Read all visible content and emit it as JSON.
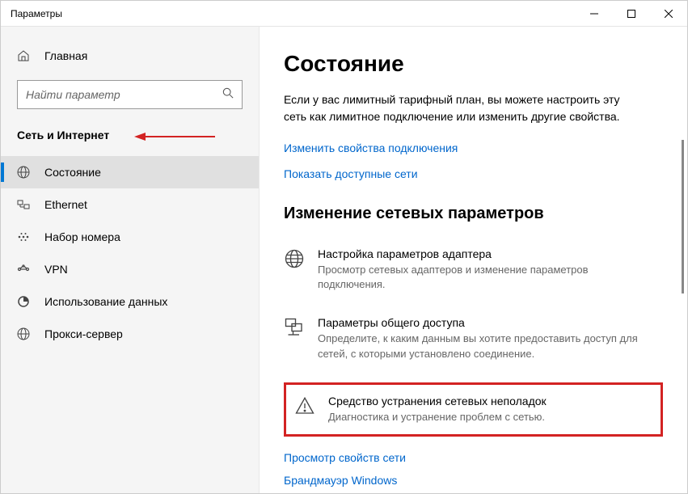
{
  "window": {
    "title": "Параметры"
  },
  "sidebar": {
    "home_label": "Главная",
    "search_placeholder": "Найти параметр",
    "category_label": "Сеть и Интернет",
    "items": [
      {
        "label": "Состояние"
      },
      {
        "label": "Ethernet"
      },
      {
        "label": "Набор номера"
      },
      {
        "label": "VPN"
      },
      {
        "label": "Использование данных"
      },
      {
        "label": "Прокси-сервер"
      }
    ]
  },
  "main": {
    "title": "Состояние",
    "desc": "Если у вас лимитный тарифный план, вы можете настроить эту сеть как лимитное подключение или изменить другие свойства.",
    "link_change_props": "Изменить свойства подключения",
    "link_show_nets": "Показать доступные сети",
    "section_title": "Изменение сетевых параметров",
    "adapter_title": "Настройка параметров адаптера",
    "adapter_desc": "Просмотр сетевых адаптеров и изменение параметров подключения.",
    "sharing_title": "Параметры общего доступа",
    "sharing_desc": "Определите, к каким данным вы хотите предоставить доступ для сетей, с которыми установлено соединение.",
    "troubleshoot_title": "Средство устранения сетевых неполадок",
    "troubleshoot_desc": "Диагностика и устранение проблем с сетью.",
    "link_net_props": "Просмотр свойств сети",
    "link_firewall": "Брандмауэр Windows"
  }
}
